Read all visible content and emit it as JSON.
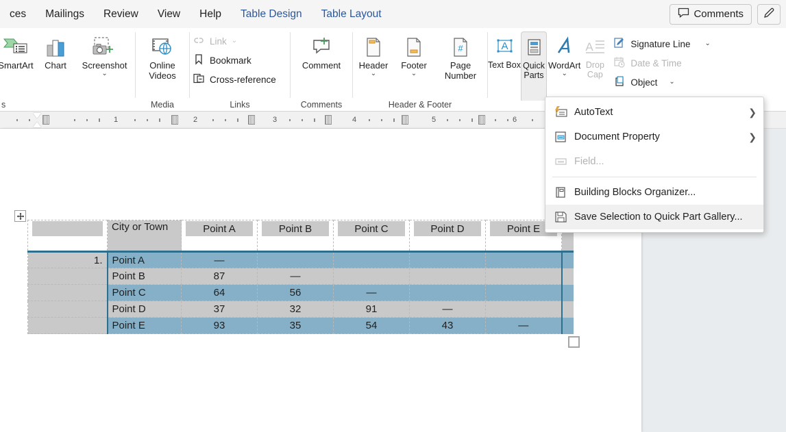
{
  "tabs": [
    {
      "label": "ces",
      "contextual": false
    },
    {
      "label": "Mailings",
      "contextual": false
    },
    {
      "label": "Review",
      "contextual": false
    },
    {
      "label": "View",
      "contextual": false
    },
    {
      "label": "Help",
      "contextual": false
    },
    {
      "label": "Table Design",
      "contextual": true
    },
    {
      "label": "Table Layout",
      "contextual": true
    }
  ],
  "titlebar": {
    "comments_label": "Comments",
    "comments_icon": "comment-bubble-icon",
    "editor_icon": "pen-editor-icon"
  },
  "ribbon": {
    "groups": [
      {
        "name": "illustrations",
        "label": "s",
        "buttons": [
          {
            "label": "SmartArt",
            "icon": "smartart-icon",
            "dropdown": false
          },
          {
            "label": "Chart",
            "icon": "chart-icon",
            "dropdown": false
          },
          {
            "label": "Screenshot",
            "icon": "screenshot-icon",
            "dropdown": true
          }
        ]
      },
      {
        "name": "media",
        "label": "Media",
        "buttons": [
          {
            "label": "Online Videos",
            "icon": "online-videos-icon",
            "dropdown": false
          }
        ]
      },
      {
        "name": "links",
        "label": "Links",
        "items": [
          {
            "label": "Link",
            "icon": "link-icon",
            "disabled": true,
            "dropdown": true
          },
          {
            "label": "Bookmark",
            "icon": "bookmark-icon",
            "disabled": false,
            "dropdown": false
          },
          {
            "label": "Cross-reference",
            "icon": "cross-reference-icon",
            "disabled": false,
            "dropdown": false
          }
        ]
      },
      {
        "name": "comments",
        "label": "Comments",
        "buttons": [
          {
            "label": "Comment",
            "icon": "new-comment-icon",
            "dropdown": false
          }
        ]
      },
      {
        "name": "header-footer",
        "label": "Header & Footer",
        "buttons": [
          {
            "label": "Header",
            "icon": "header-icon",
            "dropdown": true
          },
          {
            "label": "Footer",
            "icon": "footer-icon",
            "dropdown": true
          },
          {
            "label": "Page Number",
            "icon": "page-number-icon",
            "dropdown": true
          }
        ]
      },
      {
        "name": "text",
        "label": "",
        "buttons": [
          {
            "label": "Text Box",
            "icon": "text-box-icon",
            "dropdown": true
          },
          {
            "label": "Quick Parts",
            "icon": "quick-parts-icon",
            "dropdown": true,
            "active": true
          },
          {
            "label": "WordArt",
            "icon": "wordart-icon",
            "dropdown": true
          },
          {
            "label": "Drop Cap",
            "icon": "drop-cap-icon",
            "dropdown": true,
            "disabled": true
          }
        ],
        "items": [
          {
            "label": "Signature Line",
            "icon": "signature-line-icon",
            "disabled": false,
            "dropdown": true
          },
          {
            "label": "Date & Time",
            "icon": "date-time-icon",
            "disabled": true,
            "dropdown": false
          },
          {
            "label": "Object",
            "icon": "object-icon",
            "disabled": false,
            "dropdown": true
          }
        ]
      }
    ]
  },
  "ruler": {
    "numbers": [
      "1",
      "2",
      "3",
      "4",
      "5",
      "6"
    ]
  },
  "menu": {
    "name": "quick-parts-menu",
    "items": [
      {
        "label": "AutoText",
        "icon": "autotext-icon",
        "submenu": true,
        "disabled": false,
        "highlighted": false
      },
      {
        "label": "Document Property",
        "icon": "document-property-icon",
        "submenu": true,
        "disabled": false,
        "highlighted": false
      },
      {
        "label": "Field...",
        "icon": "field-icon",
        "submenu": false,
        "disabled": true,
        "highlighted": false
      },
      {
        "separator": true
      },
      {
        "label": "Building Blocks Organizer...",
        "icon": "building-blocks-icon",
        "submenu": false,
        "disabled": false,
        "highlighted": false
      },
      {
        "label": "Save Selection to Quick Part Gallery...",
        "icon": "save-icon",
        "submenu": false,
        "disabled": false,
        "highlighted": true
      }
    ]
  },
  "document": {
    "table": {
      "name": "distance-matrix-table",
      "headers": [
        "",
        "City or Town",
        "Point A",
        "Point B",
        "Point C",
        "Point D",
        "Point E"
      ],
      "rows": [
        {
          "num": "1.",
          "city": "Point A",
          "values": [
            "—",
            "",
            "",
            "",
            ""
          ],
          "shade": "blue"
        },
        {
          "num": "",
          "city": "Point B",
          "values": [
            "87",
            "—",
            "",
            "",
            ""
          ],
          "shade": "gray"
        },
        {
          "num": "",
          "city": "Point C",
          "values": [
            "64",
            "56",
            "—",
            "",
            ""
          ],
          "shade": "blue"
        },
        {
          "num": "",
          "city": "Point D",
          "values": [
            "37",
            "32",
            "91",
            "—",
            ""
          ],
          "shade": "gray"
        },
        {
          "num": "",
          "city": "Point E",
          "values": [
            "93",
            "35",
            "54",
            "43",
            "—"
          ],
          "shade": "blue"
        }
      ]
    }
  },
  "colors": {
    "contextual_tab": "#2b579a",
    "table_blue_row": "#86b0c8",
    "table_gray_row": "#c9c9c9",
    "selection_border": "#2e6f8e",
    "page_background": "#e9ecee"
  }
}
